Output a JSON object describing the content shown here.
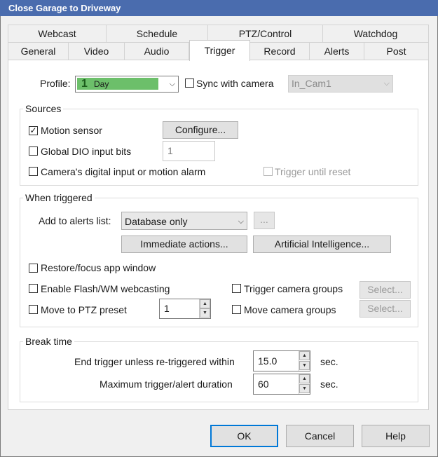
{
  "window": {
    "title": "Close Garage to Driveway"
  },
  "tabs_top": [
    "Webcast",
    "Schedule",
    "PTZ/Control",
    "Watchdog"
  ],
  "tabs_bottom": [
    "General",
    "Video",
    "Audio",
    "Trigger",
    "Record",
    "Alerts",
    "Post"
  ],
  "active_tab": "Trigger",
  "profile": {
    "label": "Profile:",
    "value": "Day",
    "number": "1",
    "fill_color": "#6cbf6a",
    "sync_label": "Sync with camera",
    "sync_checked": false,
    "camera_value": "In_Cam1"
  },
  "sources": {
    "legend": "Sources",
    "motion_sensor": {
      "label": "Motion sensor",
      "checked": true
    },
    "configure_button": "Configure...",
    "global_dio": {
      "label": "Global DIO input bits",
      "checked": false,
      "value": "1"
    },
    "camera_digital": {
      "label": "Camera's digital input or motion alarm",
      "checked": false
    },
    "trigger_until_reset": {
      "label": "Trigger until reset",
      "checked": false
    }
  },
  "when_triggered": {
    "legend": "When triggered",
    "alerts_label": "Add to alerts list:",
    "alerts_value": "Database only",
    "ellipsis_button": "...",
    "immediate_button": "Immediate actions...",
    "ai_button": "Artificial Intelligence...",
    "restore_focus": {
      "label": "Restore/focus app window",
      "checked": false
    },
    "flash_webcasting": {
      "label": "Enable Flash/WM webcasting",
      "checked": false
    },
    "move_ptz": {
      "label": "Move to PTZ preset",
      "checked": false,
      "value": "1"
    },
    "trigger_groups": {
      "label": "Trigger camera groups",
      "checked": false
    },
    "move_groups": {
      "label": "Move camera groups",
      "checked": false
    },
    "select_button_1": "Select...",
    "select_button_2": "Select..."
  },
  "break_time": {
    "legend": "Break time",
    "end_trigger_label": "End trigger unless re-triggered within",
    "end_trigger_value": "15.0",
    "max_duration_label": "Maximum trigger/alert duration",
    "max_duration_value": "60",
    "unit": "sec."
  },
  "footer": {
    "ok": "OK",
    "cancel": "Cancel",
    "help": "Help"
  }
}
